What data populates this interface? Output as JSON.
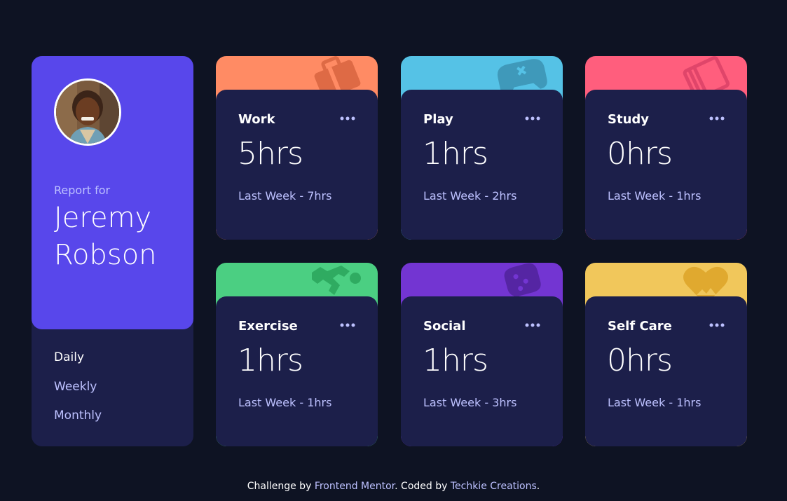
{
  "profile": {
    "report_for": "Report for",
    "name": "Jeremy Robson",
    "periods": [
      "Daily",
      "Weekly",
      "Monthly"
    ],
    "active_period": "Daily"
  },
  "cards": [
    {
      "title": "Work",
      "current": "5hrs",
      "previous": "Last Week - 7hrs",
      "color": "#ff8b64",
      "icon": "briefcase-icon"
    },
    {
      "title": "Play",
      "current": "1hrs",
      "previous": "Last Week - 2hrs",
      "color": "#55c2e6",
      "icon": "gamepad-icon"
    },
    {
      "title": "Study",
      "current": "0hrs",
      "previous": "Last Week - 1hrs",
      "color": "#ff5e7d",
      "icon": "book-icon"
    },
    {
      "title": "Exercise",
      "current": "1hrs",
      "previous": "Last Week - 1hrs",
      "color": "#4bcf82",
      "icon": "running-person-icon"
    },
    {
      "title": "Social",
      "current": "1hrs",
      "previous": "Last Week - 3hrs",
      "color": "#7335d2",
      "icon": "speech-bubble-icon"
    },
    {
      "title": "Self Care",
      "current": "0hrs",
      "previous": "Last Week - 1hrs",
      "color": "#f1c75b",
      "icon": "heart-icon"
    }
  ],
  "footer": {
    "prefix": "Challenge by ",
    "link1": "Frontend Mentor",
    "middle": ". Coded by ",
    "link2": "Techkie Creations",
    "suffix": "."
  },
  "colors": {
    "background": "#0e1323",
    "card": "#1c1f4a",
    "accent": "#5847eb",
    "muted_text": "#bdc1ff"
  }
}
